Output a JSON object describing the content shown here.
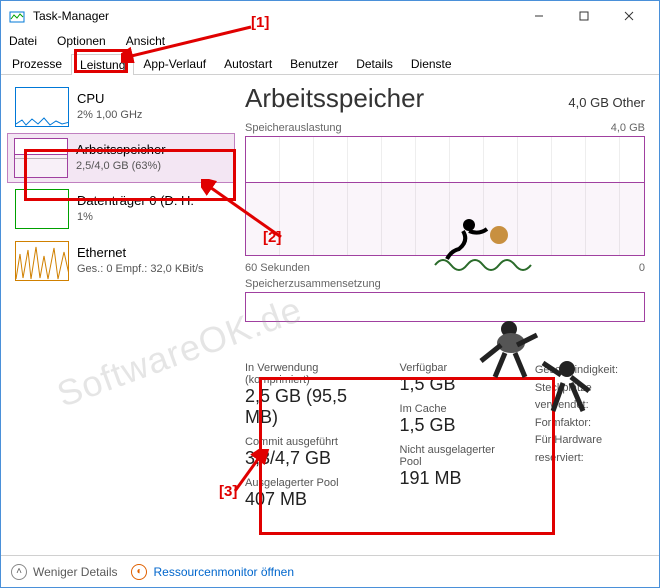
{
  "window": {
    "title": "Task-Manager"
  },
  "menu": {
    "file": "Datei",
    "options": "Optionen",
    "view": "Ansicht"
  },
  "tabs": {
    "processes": "Prozesse",
    "performance": "Leistung",
    "apphistory": "App-Verlauf",
    "autostart": "Autostart",
    "users": "Benutzer",
    "details": "Details",
    "services": "Dienste"
  },
  "sidebar": {
    "cpu": {
      "title": "CPU",
      "sub": "2%  1,00 GHz"
    },
    "mem": {
      "title": "Arbeitsspeicher",
      "sub": "2,5/4,0 GB (63%)"
    },
    "disk": {
      "title": "Datenträger 0 (D: H:",
      "sub": "1%"
    },
    "eth": {
      "title": "Ethernet",
      "sub": "Ges.: 0 Empf.: 32,0 KBit/s"
    }
  },
  "main": {
    "title": "Arbeitsspeicher",
    "type": "4,0 GB Other",
    "usageLabel": "Speicherauslastung",
    "usageMax": "4,0 GB",
    "timeaxis": "60 Sekunden",
    "timeaxisR": "0",
    "compLabel": "Speicherzusammensetzung"
  },
  "stats": {
    "inuse_lbl": "In Verwendung (komprimiert)",
    "inuse_val": "2,5 GB (95,5 MB)",
    "avail_lbl": "Verfügbar",
    "avail_val": "1,5 GB",
    "commit_lbl": "Commit ausgeführt",
    "commit_val": "3,3/4,7 GB",
    "cache_lbl": "Im Cache",
    "cache_val": "1,5 GB",
    "paged_lbl": "Ausgelagerter Pool",
    "paged_val": "407 MB",
    "nonpaged_lbl": "Nicht ausgelagerter Pool",
    "nonpaged_val": "191 MB"
  },
  "hw": {
    "speed": "Geschwindigkeit:",
    "slots": "Steckplätze verwendet:",
    "form": "Formfaktor:",
    "reserved": "Für Hardware reserviert:"
  },
  "footer": {
    "fewer": "Weniger Details",
    "resmon": "Ressourcenmonitor öffnen"
  },
  "annot": {
    "n1": "[1]",
    "n2": "[2]",
    "n3": "[3]"
  },
  "watermark": "SoftwareOK.de"
}
